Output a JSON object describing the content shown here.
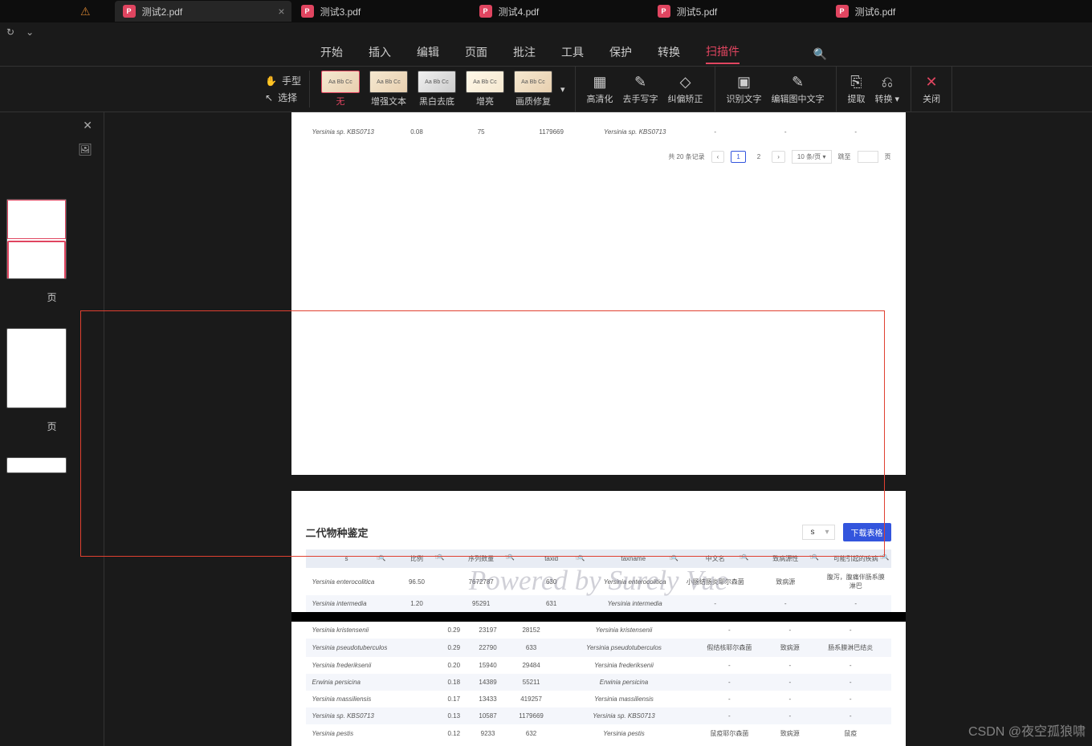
{
  "tabs": [
    {
      "label": "测试2.pdf",
      "active": true
    },
    {
      "label": "测试3.pdf",
      "active": false
    },
    {
      "label": "测试4.pdf",
      "active": false
    },
    {
      "label": "测试5.pdf",
      "active": false
    },
    {
      "label": "测试6.pdf",
      "active": false
    }
  ],
  "menu": {
    "items": [
      "开始",
      "插入",
      "编辑",
      "页面",
      "批注",
      "工具",
      "保护",
      "转换",
      "扫描件"
    ],
    "active_index": 8
  },
  "ribbon": {
    "hand": "手型",
    "select": "选择",
    "filters": [
      {
        "label": "无",
        "cls": "none"
      },
      {
        "label": "增强文本",
        "cls": "enh"
      },
      {
        "label": "黑白去底",
        "cls": "bw"
      },
      {
        "label": "增亮",
        "cls": "bright"
      },
      {
        "label": "画质修复",
        "cls": "qual"
      }
    ],
    "hd": "高清化",
    "handwrite": "去手写字",
    "deskew": "纠偏矫正",
    "ocr": "识别文字",
    "edit_chars": "编辑图中文字",
    "extract": "提取",
    "convert": "转换",
    "close": "关闭"
  },
  "sidebar": {
    "label1": "页",
    "label2": "页"
  },
  "page1": {
    "row": {
      "c0": "Yersinia sp. KBS0713",
      "c1": "0.08",
      "c2": "75",
      "c3": "1179669",
      "c4": "Yersinia sp. KBS0713",
      "c5": "-",
      "c6": "-",
      "c7": "-"
    },
    "pagination": {
      "total": "共 20 条记录",
      "p1": "1",
      "p2": "2",
      "per": "10 条/页",
      "jump": "跳至",
      "page_sfx": "页"
    }
  },
  "page2": {
    "title": "二代物种鉴定",
    "sel_val": "s",
    "btn": "下载表格",
    "headers": [
      "s",
      "比例",
      "序列数量",
      "taxid",
      "taxname",
      "中文名",
      "致病源性",
      "可能引起的疾病"
    ],
    "rows": [
      {
        "c0": "Yersinia enterocolitica",
        "c1": "96.50",
        "c2": "7672787",
        "c3": "630",
        "c4": "Yersinia enterocolitica",
        "c5": "小肠结肠炎耶尔森菌",
        "c6": "致病源",
        "c7": "腹泻，腹痛伴肠系膜淋巴"
      },
      {
        "c0": "Yersinia intermedia",
        "c1": "1.20",
        "c2": "95291",
        "c3": "631",
        "c4": "Yersinia intermedia",
        "c5": "-",
        "c6": "-",
        "c7": "-"
      }
    ],
    "watermark": "Powered by Surely Vue"
  },
  "page3": {
    "rows": [
      {
        "c0": "Yersinia kristensenii",
        "c1": "0.29",
        "c2": "23197",
        "c3": "28152",
        "c4": "Yersinia kristensenii",
        "c5": "-",
        "c6": "-",
        "c7": "-"
      },
      {
        "c0": "Yersinia pseudotuberculos",
        "c1": "0.29",
        "c2": "22790",
        "c3": "633",
        "c4": "Yersinia pseudotuberculos",
        "c5": "假结核耶尔森菌",
        "c6": "致病源",
        "c7": "肠系膜淋巴结炎"
      },
      {
        "c0": "Yersinia frederiksenii",
        "c1": "0.20",
        "c2": "15940",
        "c3": "29484",
        "c4": "Yersinia frederiksenii",
        "c5": "-",
        "c6": "-",
        "c7": "-"
      },
      {
        "c0": "Erwinia persicina",
        "c1": "0.18",
        "c2": "14389",
        "c3": "55211",
        "c4": "Erwinia persicina",
        "c5": "-",
        "c6": "-",
        "c7": "-"
      },
      {
        "c0": "Yersinia massiliensis",
        "c1": "0.17",
        "c2": "13433",
        "c3": "419257",
        "c4": "Yersinia massiliensis",
        "c5": "-",
        "c6": "-",
        "c7": "-"
      },
      {
        "c0": "Yersinia sp. KBS0713",
        "c1": "0.13",
        "c2": "10587",
        "c3": "1179669",
        "c4": "Yersinia sp. KBS0713",
        "c5": "-",
        "c6": "-",
        "c7": "-"
      },
      {
        "c0": "Yersinia pestis",
        "c1": "0.12",
        "c2": "9233",
        "c3": "632",
        "c4": "Yersinia pestis",
        "c5": "鼠疫耶尔森菌",
        "c6": "致病源",
        "c7": "鼠疫"
      }
    ]
  },
  "csdn": "CSDN @夜空孤狼啸"
}
